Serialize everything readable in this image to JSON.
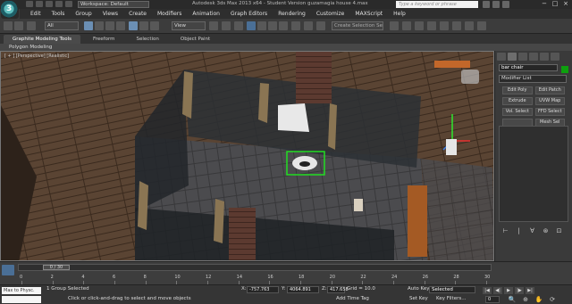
{
  "titlebar": {
    "app_logo": "3",
    "workspace": "Workspace: Default",
    "window_title": "Autodesk 3ds Max 2013 x64 - Student Version    guzamagia house 4.max",
    "search_placeholder": "Type a keyword or phrase",
    "win_controls": [
      "−",
      "□",
      "×"
    ]
  },
  "menu": [
    "Edit",
    "Tools",
    "Group",
    "Views",
    "Create",
    "Modifiers",
    "Animation",
    "Graph Editors",
    "Rendering",
    "Customize",
    "MAXScript",
    "Help"
  ],
  "toolbar": {
    "selection_filter": "All",
    "reference_coord": "View",
    "create_selection_set": "Create Selection Se"
  },
  "ribbon": {
    "tabs": [
      "Graphite Modeling Tools",
      "Freeform",
      "Selection",
      "Object Paint"
    ],
    "panel_label": "Polygon Modeling"
  },
  "viewport": {
    "label": "[ + ] [Perspective] [Realistic]"
  },
  "command_panel": {
    "object_name": "bar chair",
    "object_color": "#0ea00e",
    "modifier_list": "Modifier List",
    "modifier_buttons": [
      "Edit Poly",
      "Edit Patch",
      "Extrude",
      "UVW Map",
      "Vol. Select",
      "FFD Select",
      "",
      "Mesh Sel"
    ],
    "stack_tools": [
      "⊢",
      "|",
      "∀",
      "⊛",
      "⊡"
    ]
  },
  "timeline": {
    "slider": "0 / 30",
    "ticks": [
      "0",
      "2",
      "4",
      "6",
      "8",
      "10",
      "12",
      "14",
      "16",
      "18",
      "20",
      "22",
      "24",
      "26",
      "28",
      "30"
    ]
  },
  "statusbar": {
    "maxscript": "Max to Physc.",
    "selection": "1 Group Selected",
    "prompt": "Click or click-and-drag to select and move objects",
    "x_label": "X:",
    "x_value": "-757.763",
    "y_label": "Y:",
    "y_value": "4064.891",
    "z_label": "Z:",
    "z_value": "417.658",
    "grid": "Grid = 10.0",
    "add_time_tag": "Add Time Tag",
    "auto_key": "Auto Key",
    "key_mode": "Selected",
    "set_key": "Set Key",
    "key_filters": "Key Filters...",
    "frame": "0",
    "playback": [
      "|◀",
      "◀|",
      "▶",
      "|▶",
      "▶|"
    ],
    "nav_icons": [
      "🔍",
      "⊕",
      "✋",
      "⟳"
    ]
  }
}
